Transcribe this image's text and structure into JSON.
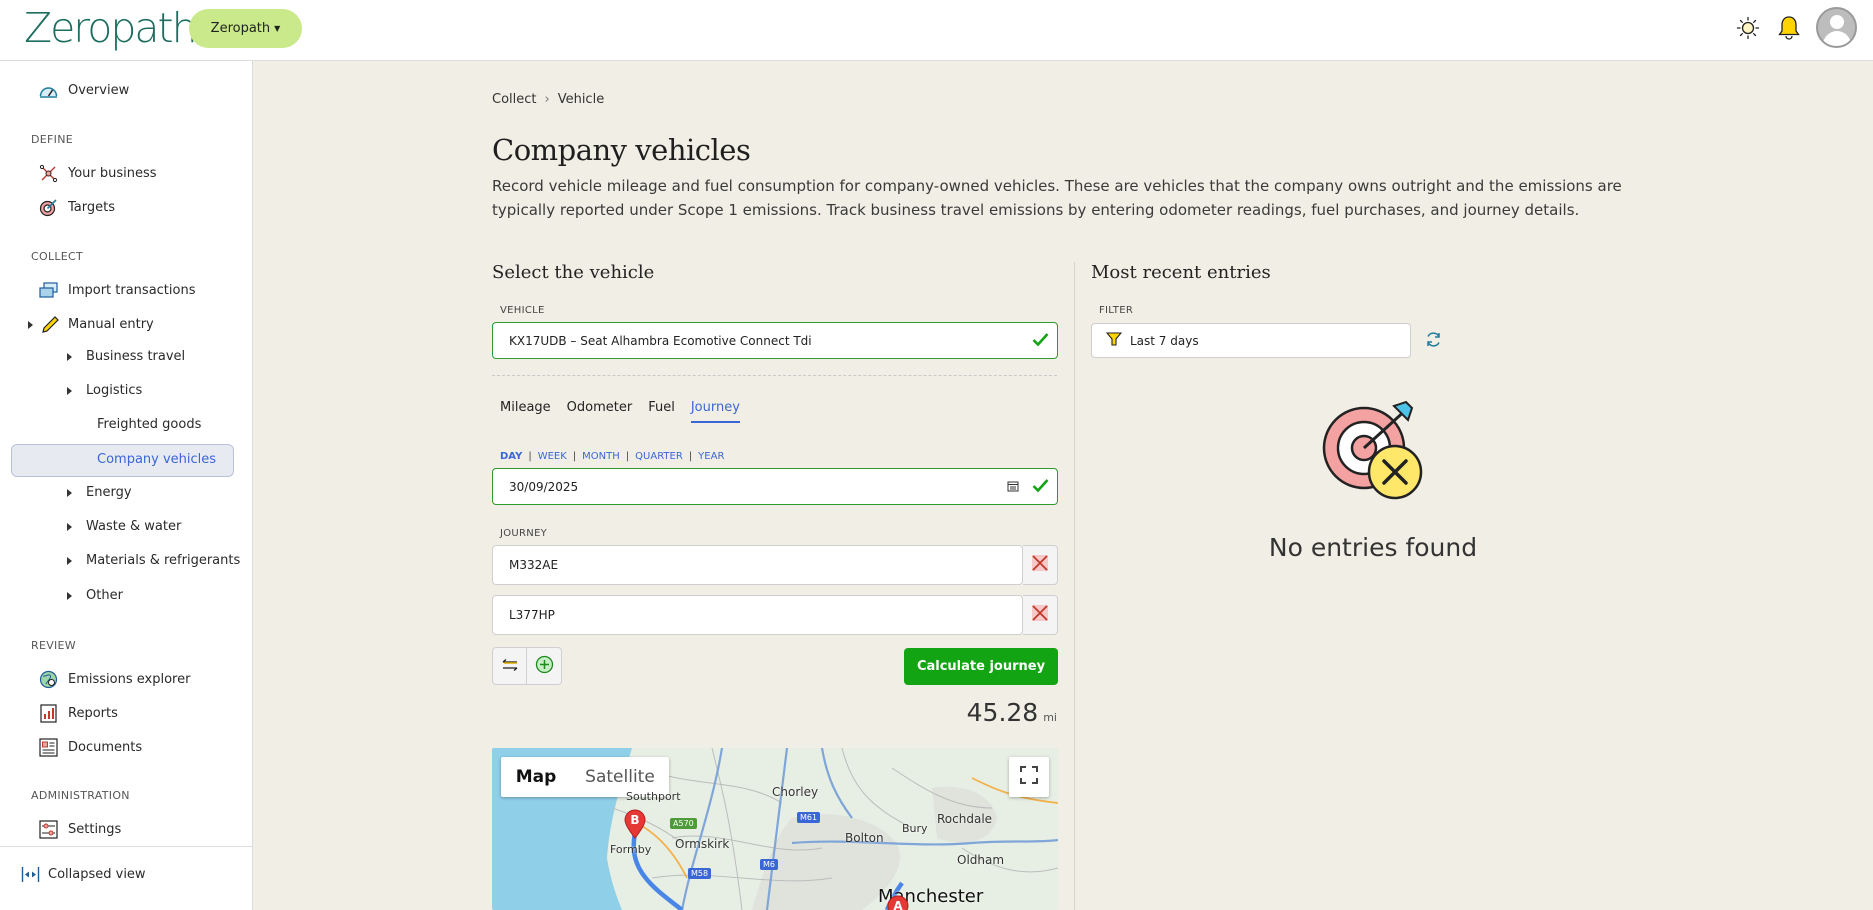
{
  "header": {
    "logo_text": "Zeropath",
    "org_label": "Zeropath",
    "icons": [
      "sun-icon",
      "bell-icon",
      "avatar"
    ]
  },
  "sidebar": {
    "overview": "Overview",
    "section_define": "DEFINE",
    "your_business": "Your business",
    "targets": "Targets",
    "section_collect": "COLLECT",
    "import_transactions": "Import transactions",
    "manual_entry": "Manual entry",
    "business_travel": "Business travel",
    "logistics": "Logistics",
    "freighted_goods": "Freighted goods",
    "company_vehicles": "Company vehicles",
    "energy": "Energy",
    "waste_water": "Waste & water",
    "materials": "Materials & refrigerants",
    "other": "Other",
    "section_review": "REVIEW",
    "emissions_explorer": "Emissions explorer",
    "reports": "Reports",
    "documents": "Documents",
    "section_admin": "ADMINISTRATION",
    "settings": "Settings",
    "collapsed_view": "Collapsed view"
  },
  "breadcrumb": {
    "root": "Collect",
    "current": "Vehicle"
  },
  "page": {
    "title": "Company vehicles",
    "description": "Record vehicle mileage and fuel consumption for company-owned vehicles. These are vehicles that the company owns outright and the emissions are typically reported under Scope 1 emissions. Track business travel emissions by entering odometer readings, fuel purchases, and journey details."
  },
  "form": {
    "title": "Select the vehicle",
    "vehicle_label": "VEHICLE",
    "vehicle_value": "KX17UDB – Seat Alhambra Ecomotive Connect Tdi",
    "tabs": [
      "Mileage",
      "Odometer",
      "Fuel",
      "Journey"
    ],
    "active_tab": "Journey",
    "periods": [
      "DAY",
      "WEEK",
      "MONTH",
      "QUARTER",
      "YEAR"
    ],
    "active_period": "DAY",
    "date_value": "30/09/2025",
    "journey_label": "JOURNEY",
    "stop_1": "M332AE",
    "stop_2": "L377HP",
    "calculate_label": "Calculate journey",
    "distance_value": "45.28",
    "distance_unit": "mi"
  },
  "map": {
    "map_label": "Map",
    "satellite_label": "Satellite",
    "places": [
      "Southport",
      "Chorley",
      "Rochdale",
      "Bury",
      "Ormskirk",
      "Bolton",
      "Formby",
      "Oldham",
      "Manchester"
    ],
    "roads": [
      "A570",
      "M61",
      "M6",
      "M58"
    ],
    "marker_b": "B",
    "marker_a": "A"
  },
  "recent": {
    "title": "Most recent entries",
    "filter_label": "FILTER",
    "filter_value": "Last 7 days",
    "empty_message": "No entries found"
  },
  "colors": {
    "accent_green": "#12a412",
    "link_blue": "#3b66d6",
    "org_button": "#c9e98a",
    "background": "#f1efe5"
  }
}
